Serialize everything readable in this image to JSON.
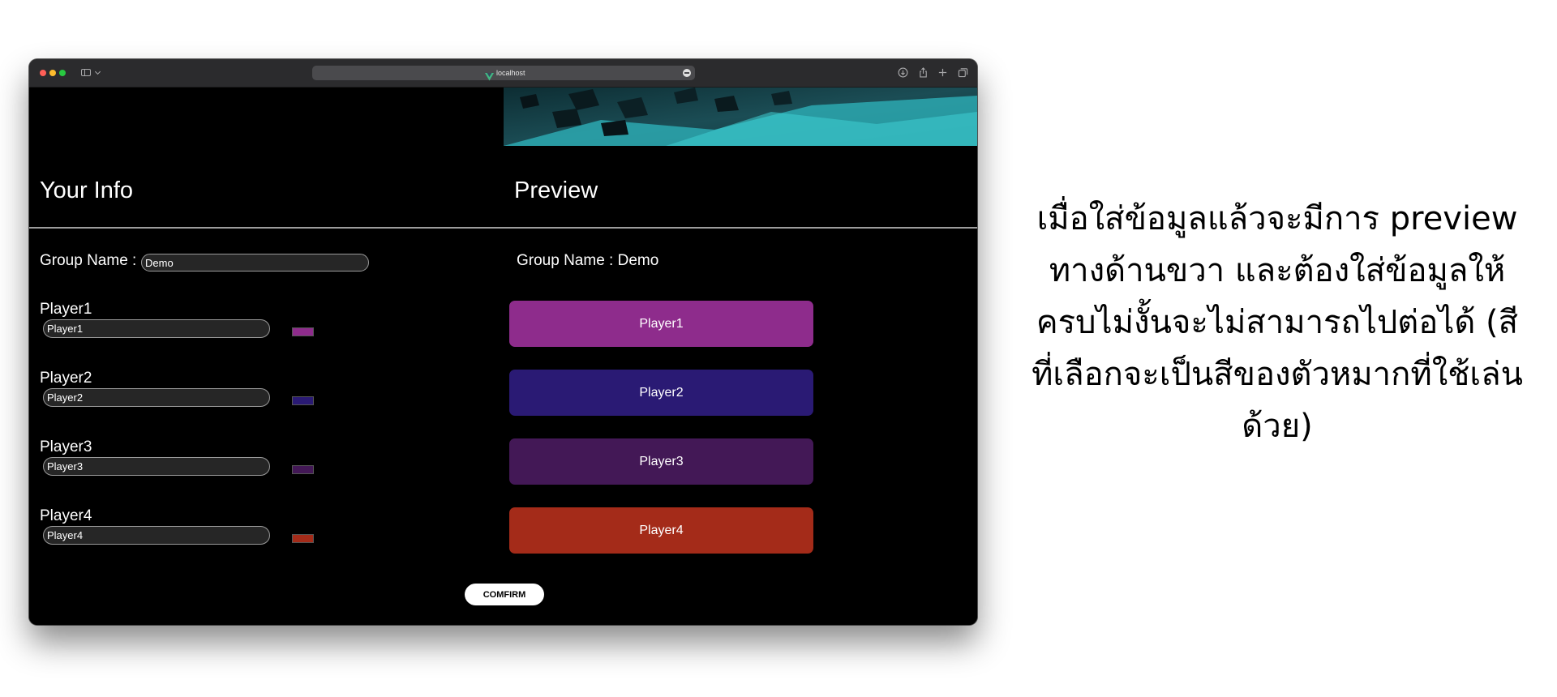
{
  "browser": {
    "url": "localhost"
  },
  "your_info": {
    "title": "Your Info",
    "group_label": "Group Name :",
    "group_value": "Demo",
    "players": [
      {
        "label": "Player1",
        "value": "Player1",
        "color": "#8e2c8c"
      },
      {
        "label": "Player2",
        "value": "Player2",
        "color": "#2a1a74"
      },
      {
        "label": "Player3",
        "value": "Player3",
        "color": "#431856"
      },
      {
        "label": "Player4",
        "value": "Player4",
        "color": "#a42b19"
      }
    ]
  },
  "preview": {
    "title": "Preview",
    "group_text": "Group Name : Demo",
    "cards": [
      {
        "label": "Player1",
        "color": "#8e2c8c"
      },
      {
        "label": "Player2",
        "color": "#2a1a74"
      },
      {
        "label": "Player3",
        "color": "#431856"
      },
      {
        "label": "Player4",
        "color": "#a42b19"
      }
    ]
  },
  "confirm_label": "COMFIRM",
  "caption": "เมื่อใส่ข้อมูลแล้วจะมีการ preview ทางด้านขวา และต้องใส่ข้อมูลให้ครบไม่งั้นจะไม่สามารถไปต่อได้ (สีที่เลือกจะเป็นสีของตัวหมากที่ใช้เล่นด้วย)"
}
